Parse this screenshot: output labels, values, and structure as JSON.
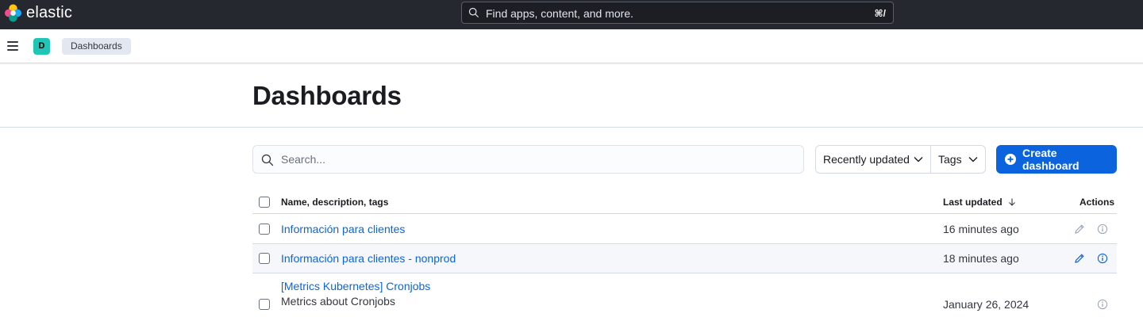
{
  "header": {
    "brand": "elastic",
    "search_placeholder": "Find apps, content, and more.",
    "search_shortcut": "⌘/"
  },
  "breadcrumbs": {
    "space_initial": "D",
    "current": "Dashboards"
  },
  "page": {
    "title": "Dashboards"
  },
  "toolbar": {
    "search_placeholder": "Search...",
    "sort_label": "Recently updated",
    "tags_label": "Tags",
    "create_label": "Create dashboard"
  },
  "table": {
    "columns": {
      "name": "Name, description, tags",
      "updated": "Last updated",
      "actions": "Actions"
    },
    "rows": [
      {
        "name": "Información para clientes",
        "description": "",
        "updated": "16 minutes ago"
      },
      {
        "name": "Información para clientes - nonprod",
        "description": "",
        "updated": "18 minutes ago"
      },
      {
        "name": "[Metrics Kubernetes] Cronjobs",
        "description": "Metrics about Cronjobs",
        "updated": "January 26, 2024"
      }
    ]
  },
  "colors": {
    "header_bg": "#25282f",
    "accent": "#0b64dd",
    "space_avatar": "#20c5b6"
  },
  "icons": [
    "search-icon",
    "menu-icon",
    "chevron-down-icon",
    "plus-circle-icon",
    "sort-down-icon",
    "pencil-icon",
    "info-icon"
  ]
}
